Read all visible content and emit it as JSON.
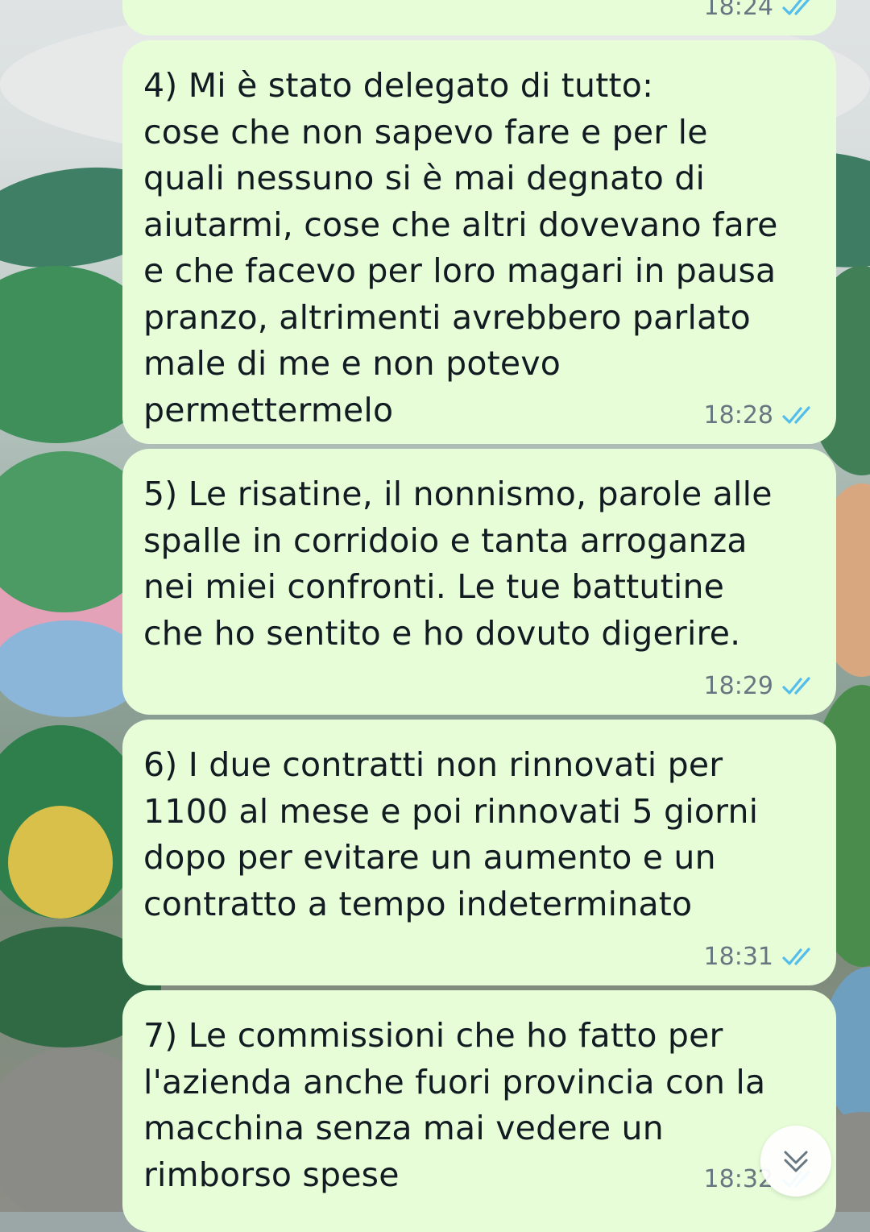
{
  "messages": [
    {
      "text": "",
      "time": "18:24",
      "status": "read"
    },
    {
      "text": "4) Mi è stato delegato di tutto:\ncose che non sapevo fare e per le quali nessuno si è mai degnato di aiutarmi, cose che altri dovevano fare e che facevo per loro magari in pausa pranzo, altrimenti avrebbero parlato male di me e non potevo permettermelo",
      "time": "18:28",
      "status": "read"
    },
    {
      "text": "5) Le risatine, il nonnismo, parole alle spalle in corridoio e tanta arroganza nei miei confronti. Le tue battutine che ho sentito e ho dovuto digerire.",
      "time": "18:29",
      "status": "read"
    },
    {
      "text": "6) I due contratti non rinnovati per 1100 al mese e poi rinnovati 5 giorni dopo per evitare un aumento e un contratto a tempo indeterminato",
      "time": "18:31",
      "status": "read"
    },
    {
      "text": "7) Le commissioni che ho fatto per l'azienda anche fuori provincia con la macchina senza mai vedere un rimborso spese",
      "time": "18:32",
      "status": "read"
    }
  ],
  "colors": {
    "bubble": "#e7fdd8",
    "read_ticks": "#53bdeb",
    "time_text": "#667781"
  },
  "icons": {
    "read_receipt": "double-check-icon",
    "scroll_down": "double-chevron-down-icon"
  }
}
